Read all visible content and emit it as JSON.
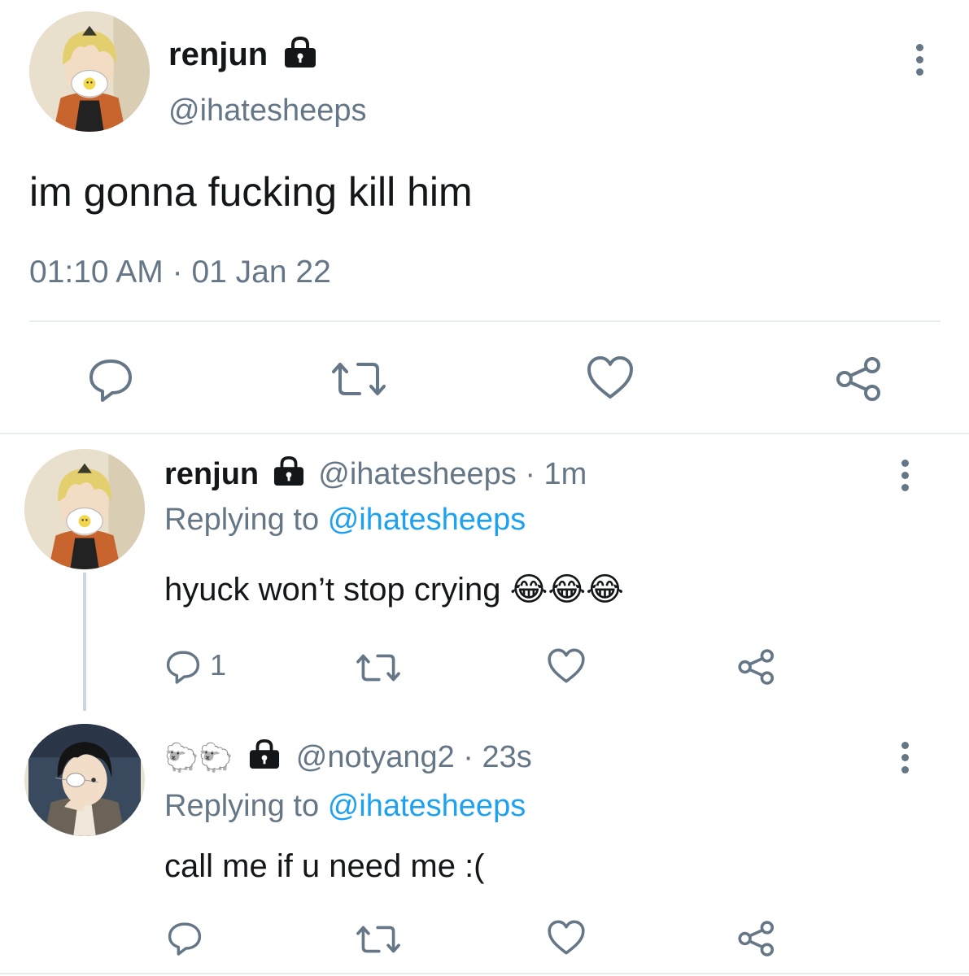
{
  "main_tweet": {
    "author_name": "renjun",
    "author_handle": "@ihatesheeps",
    "text": "im gonna fucking kill him",
    "time": "01:10 AM",
    "separator": "·",
    "date": "01 Jan 22"
  },
  "replies": [
    {
      "author_name": "renjun",
      "author_handle": "@ihatesheeps",
      "age": "1m",
      "replying_label": "Replying to",
      "replying_to": "@ihatesheeps",
      "text": "hyuck won’t stop crying 😂😂😂",
      "reply_count": "1"
    },
    {
      "author_name": "🐑🐑",
      "author_handle": "@notyang2",
      "age": "23s",
      "replying_label": "Replying to",
      "replying_to": "@ihatesheeps",
      "text": "call me if u need me :("
    }
  ],
  "separator": "·",
  "icons": {
    "reply": "reply-icon",
    "retweet": "retweet-icon",
    "like": "heart-icon",
    "share": "share-icon",
    "more": "more-icon",
    "lock": "lock-icon"
  },
  "colors": {
    "text": "#14171a",
    "secondary": "#657786",
    "link": "#1da1f2",
    "divider": "#e6ecf0"
  }
}
